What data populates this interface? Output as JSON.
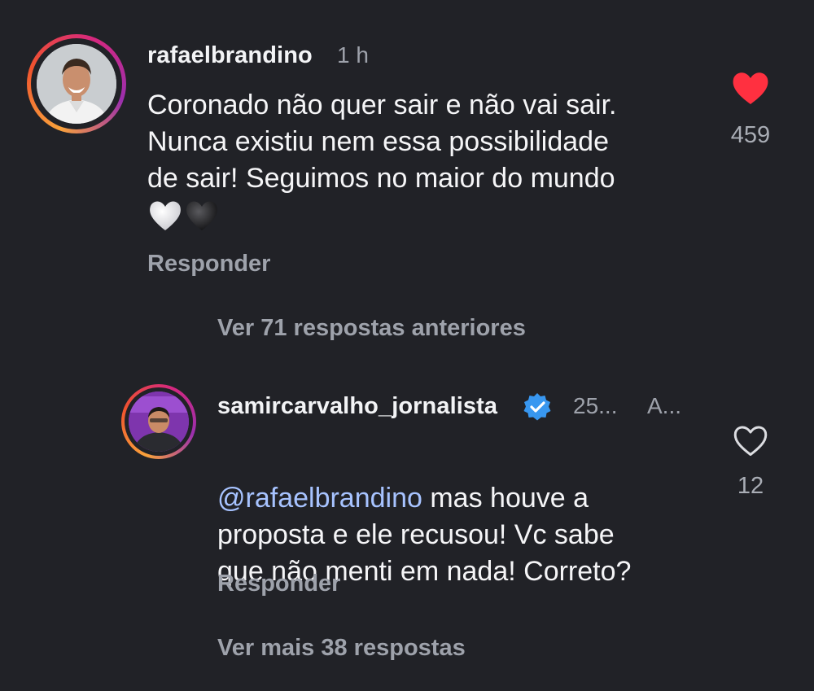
{
  "comments": [
    {
      "username": "rafaelbrandino",
      "time": "1 h",
      "text": "Coronado não quer sair e não vai sair.\nNunca existiu nem essa possibilidade\nde sair! Seguimos no maior do mundo",
      "emojis": [
        "white-heart-emoji",
        "black-heart-emoji"
      ],
      "reply_label": "Responder",
      "likes": "459",
      "liked": true,
      "colors": {
        "like": "#ff3040"
      }
    }
  ],
  "view_previous": "Ver 71 respostas anteriores",
  "reply": {
    "username": "samircarvalho_jornalista",
    "verified": true,
    "time": "25...",
    "extra": "A...",
    "mention": "@rafaelbrandino",
    "text_after_mention": " mas houve a",
    "text_rest": "proposta e ele recusou! Vc sabe\nque não menti em nada! Correto?",
    "reply_label": "Responder",
    "likes": "12",
    "liked": false
  },
  "view_more": "Ver mais 38 respostas",
  "colors": {
    "background": "#212227",
    "mention": "#a7c3ff",
    "verified": "#3897f0"
  }
}
